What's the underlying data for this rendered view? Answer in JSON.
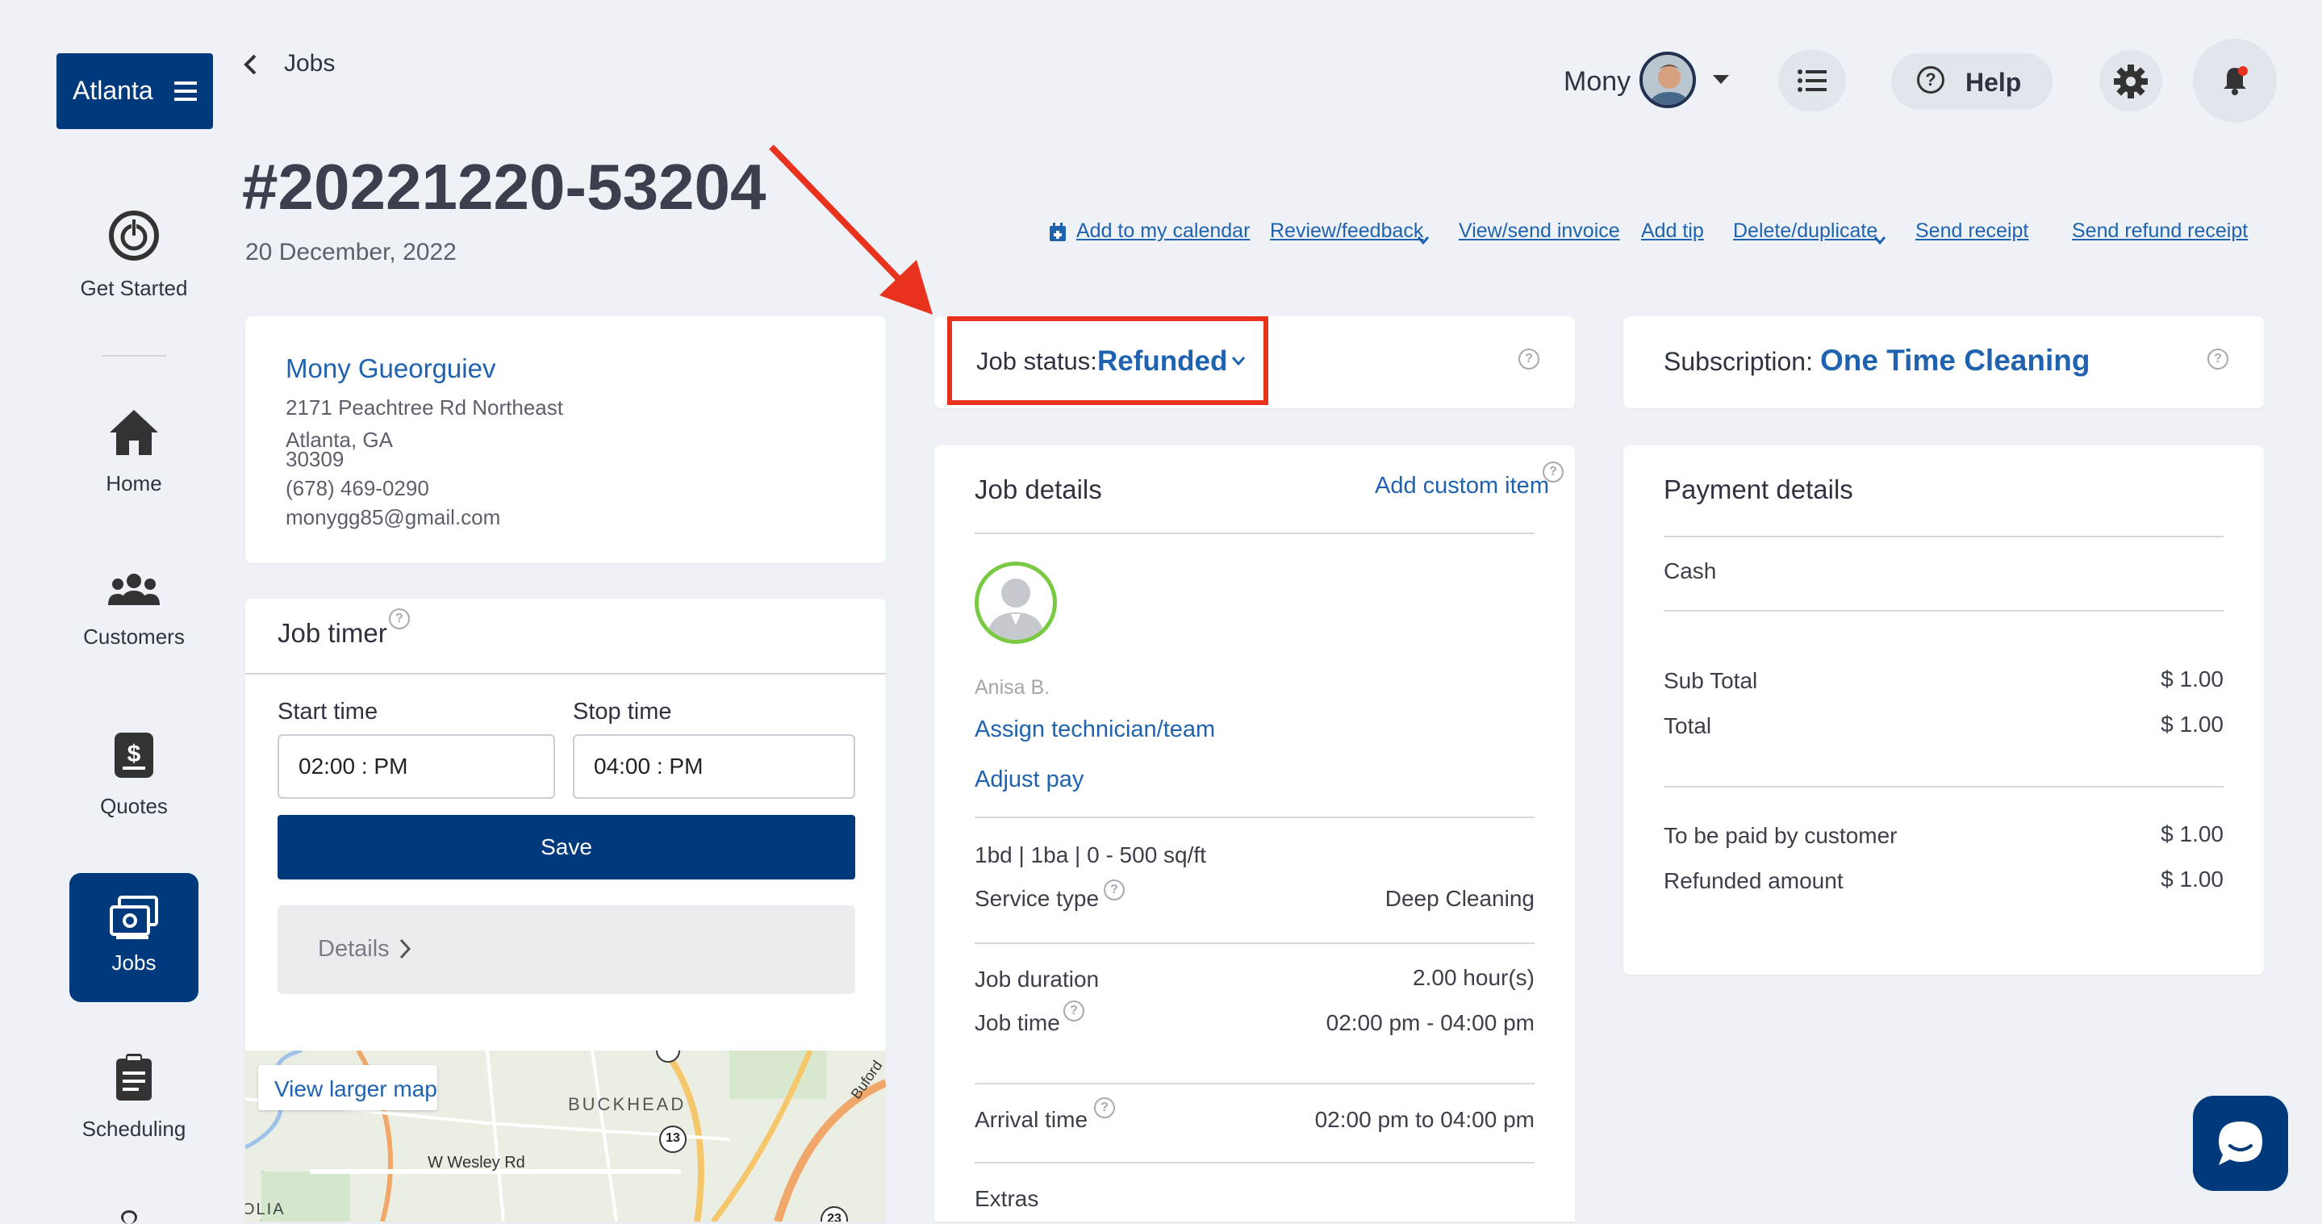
{
  "sidebar": {
    "location_label": "Atlanta",
    "items": [
      {
        "label": "Get Started"
      },
      {
        "label": "Home"
      },
      {
        "label": "Customers"
      },
      {
        "label": "Quotes"
      },
      {
        "label": "Jobs"
      },
      {
        "label": "Scheduling"
      }
    ]
  },
  "header": {
    "breadcrumb": "Jobs",
    "user_name": "Mony",
    "help_label": "Help"
  },
  "job": {
    "number": "#20221220-53204",
    "date": "20 December, 2022"
  },
  "actions": {
    "add_to_calendar": "Add to my calendar",
    "review_feedback": "Review/feedback",
    "view_send_invoice": "View/send invoice",
    "add_tip": "Add tip",
    "delete_duplicate": "Delete/duplicate",
    "send_receipt": "Send receipt",
    "send_refund_receipt": "Send refund receipt"
  },
  "customer": {
    "name": "Mony Gueorguiev",
    "address1": "2171 Peachtree Rd Northeast",
    "city_state": "Atlanta, GA",
    "zip": "30309",
    "phone": "(678) 469-0290",
    "email": "monygg85@gmail.com"
  },
  "timer": {
    "title": "Job timer",
    "start_label": "Start time",
    "stop_label": "Stop time",
    "start_value": "02:00 : PM",
    "stop_value": "04:00 : PM",
    "save_label": "Save",
    "details_label": "Details"
  },
  "map": {
    "view_larger": "View larger map",
    "area_label": "BUCKHEAD",
    "road_label": "W Wesley Rd",
    "road2_label": "Buford",
    "route_13": "13",
    "route_23": "23",
    "edge_label": "OLIA"
  },
  "status": {
    "label": "Job status:",
    "value": "Refunded"
  },
  "subscription": {
    "label": "Subscription:",
    "value": "One Time Cleaning"
  },
  "job_details": {
    "title": "Job details",
    "add_custom_item": "Add custom item",
    "technician_name": "Anisa B.",
    "assign_label": "Assign technician/team",
    "adjust_pay_label": "Adjust pay",
    "summary": "1bd | 1ba | 0 - 500 sq/ft",
    "service_type_label": "Service type",
    "service_type_value": "Deep Cleaning",
    "duration_label": "Job duration",
    "duration_value": "2.00 hour(s)",
    "job_time_label": "Job time",
    "job_time_value": "02:00 pm - 04:00 pm",
    "arrival_label": "Arrival time",
    "arrival_value": "02:00 pm to 04:00 pm",
    "extras_label": "Extras"
  },
  "payment": {
    "title": "Payment details",
    "method": "Cash",
    "subtotal_label": "Sub Total",
    "subtotal_value": "$ 1.00",
    "total_label": "Total",
    "total_value": "$ 1.00",
    "to_be_paid_label": "To be paid by customer",
    "to_be_paid_value": "$ 1.00",
    "refunded_label": "Refunded amount",
    "refunded_value": "$ 1.00"
  },
  "colors": {
    "brand_navy": "#003a7d",
    "link_blue": "#1f63b0",
    "annotation_red": "#e8321e"
  }
}
